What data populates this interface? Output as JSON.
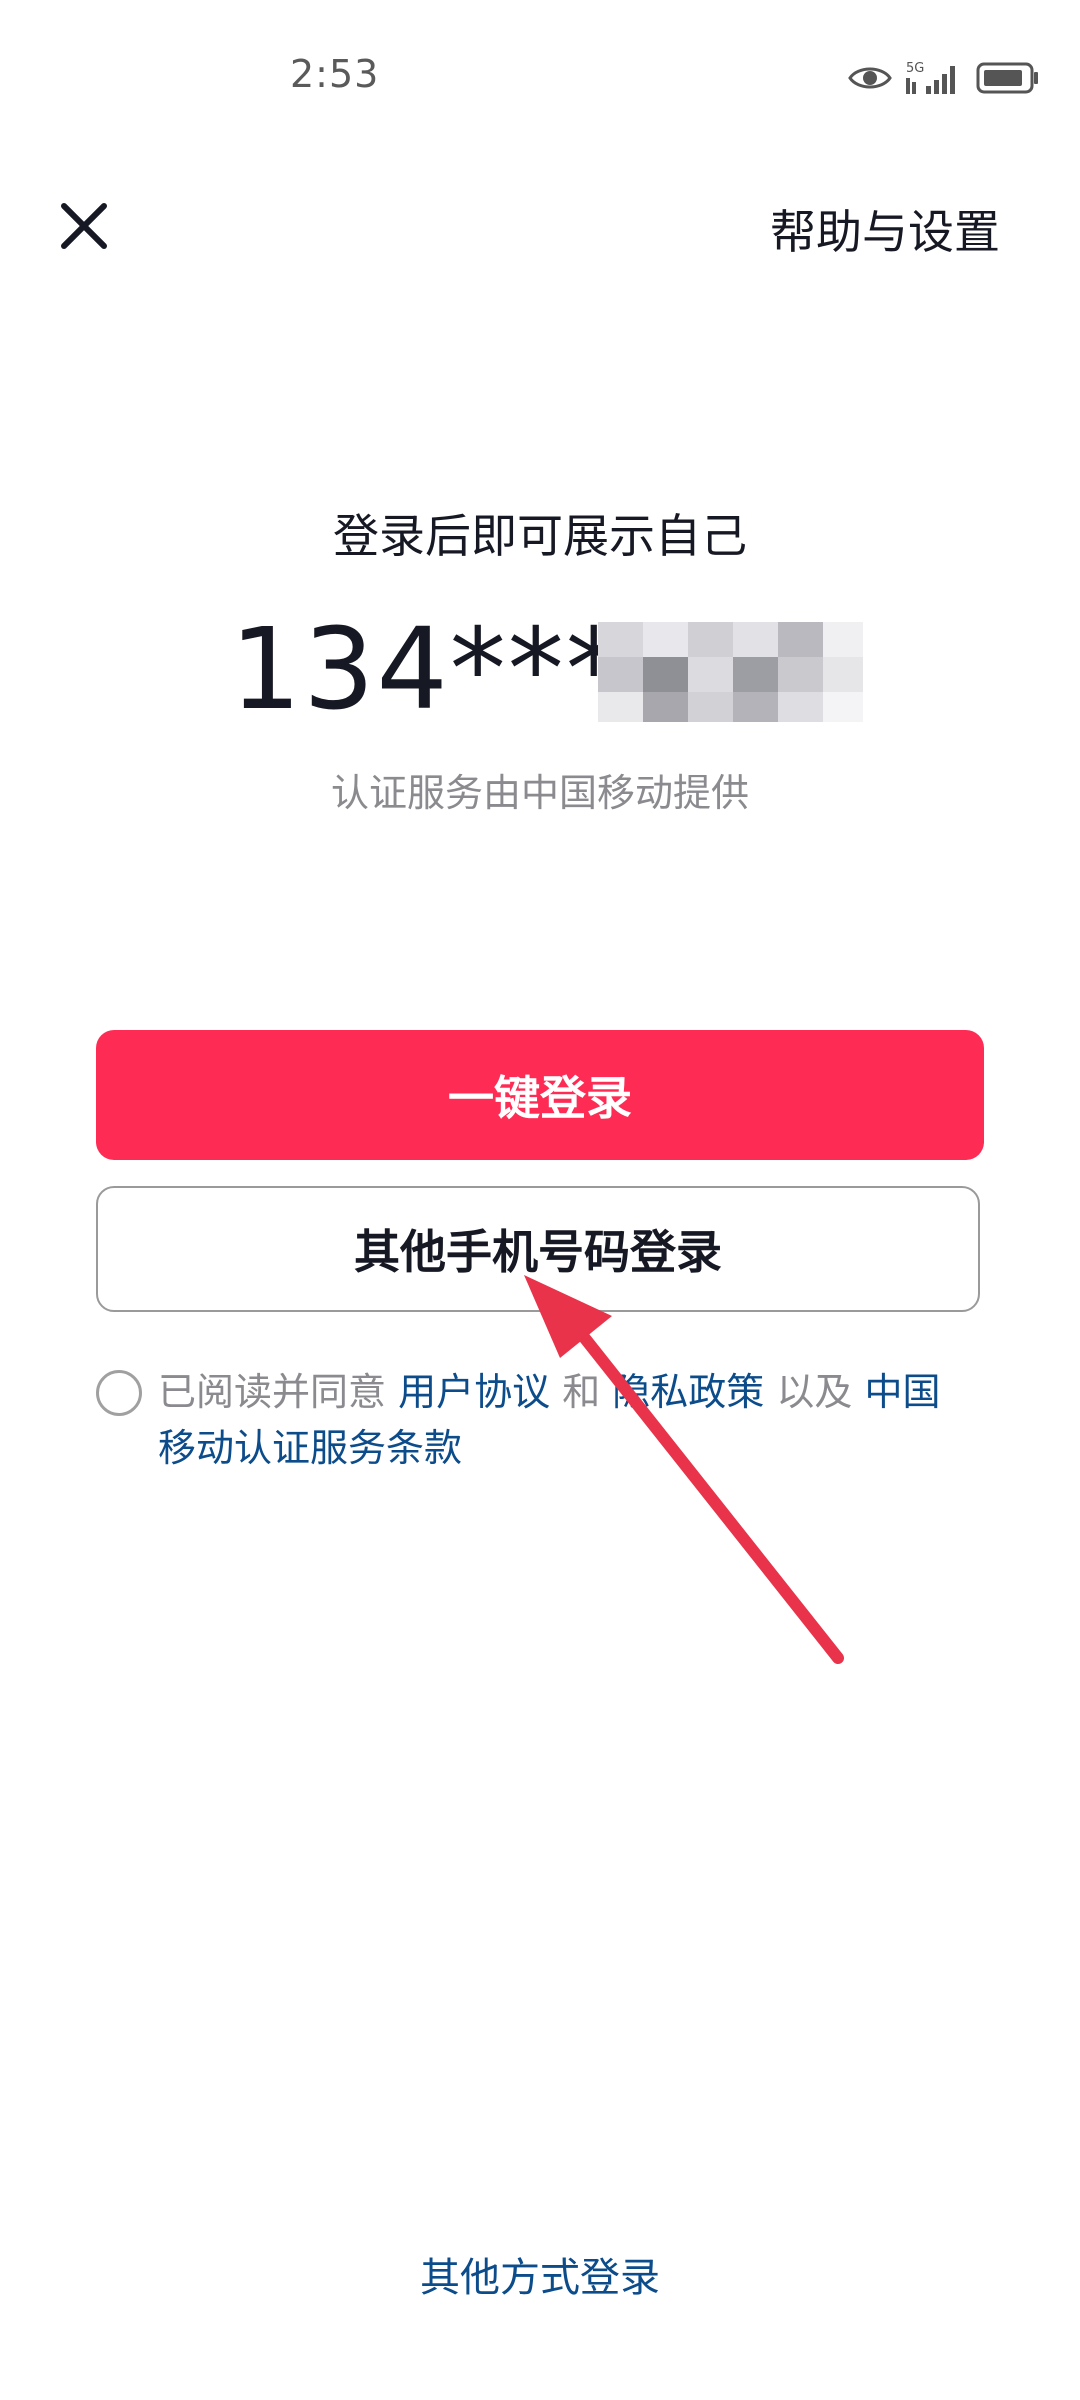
{
  "status_bar": {
    "time": "2:53",
    "icons": [
      "eye-icon",
      "5g-signal-icon",
      "battery-icon"
    ],
    "network_label": "5G"
  },
  "header": {
    "close_icon": "close-icon",
    "help_label": "帮助与设置"
  },
  "main": {
    "subtitle": "登录后即可展示自己",
    "phone_masked": "134****",
    "provider_note": "认证服务由中国移动提供",
    "one_click_login_label": "一键登录",
    "other_phone_login_label": "其他手机号码登录"
  },
  "agreement": {
    "prefix": "已阅读并同意 ",
    "user_agreement": "用户协议",
    "and": " 和 ",
    "privacy_policy": "隐私政策",
    "also": " 以及 ",
    "cmcc_terms": "中国移动认证服务条款",
    "checked": false
  },
  "footer": {
    "other_methods_label": "其他方式登录"
  },
  "colors": {
    "primary": "#fe2c55",
    "link": "#0c4c8a",
    "annotation_arrow": "#e8334a"
  }
}
